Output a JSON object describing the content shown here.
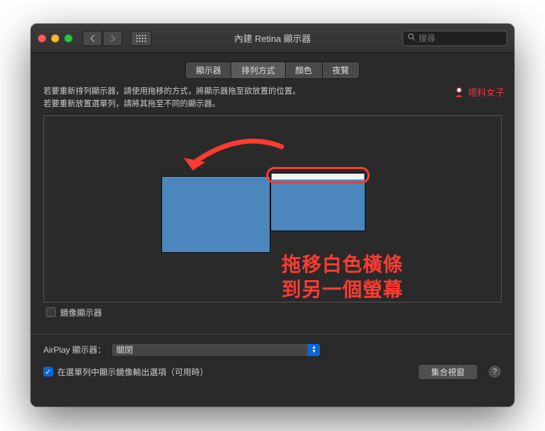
{
  "window": {
    "title": "內建 Retina 顯示器",
    "search_placeholder": "搜尋"
  },
  "tabs": [
    {
      "label": "顯示器",
      "active": false
    },
    {
      "label": "排列方式",
      "active": true
    },
    {
      "label": "顏色",
      "active": false
    },
    {
      "label": "夜覽",
      "active": false
    }
  ],
  "instructions": {
    "line1": "若要重新排列顯示器，請使用拖移的方式，將顯示器拖至欲放置的位置。",
    "line2": "若要重新放置選單列，請將其拖至不同的顯示器。"
  },
  "mirror": {
    "label": "鏡像顯示器",
    "checked": false
  },
  "airplay": {
    "label": "AirPlay 顯示器：",
    "value": "關閉"
  },
  "show_mirror_options": {
    "label": "在選單列中顯示鏡像輸出選項（可用時）",
    "checked": true
  },
  "gather_button": "集合視窗",
  "annotation": {
    "line1": "拖移白色橫條",
    "line2": "到另一個螢幕"
  },
  "watermark": "塔科女子",
  "icons": {
    "back": "‹",
    "forward": "›",
    "search": "🔍",
    "check": "✓",
    "help": "?",
    "up": "▲",
    "down": "▼"
  }
}
